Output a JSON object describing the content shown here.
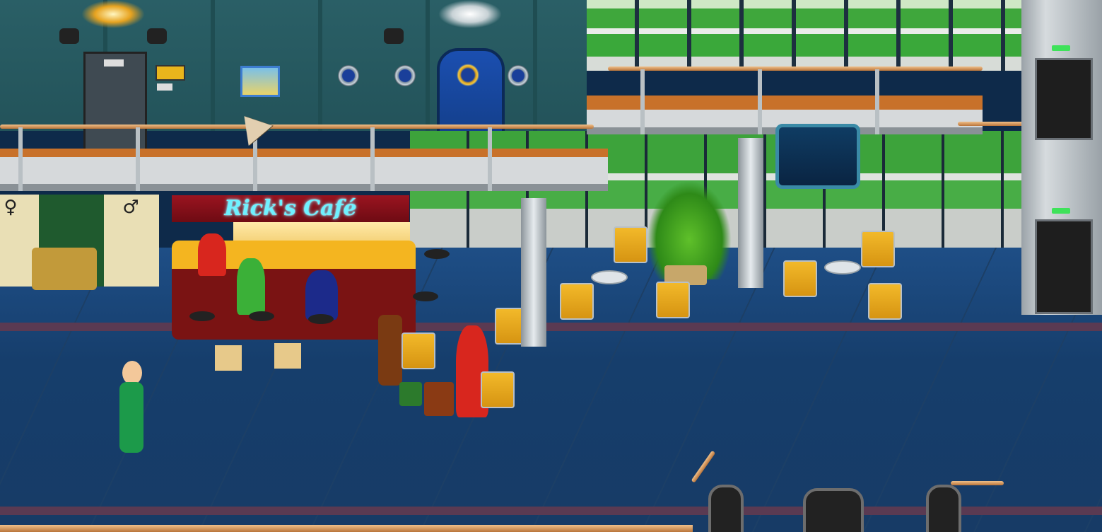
{
  "scene": {
    "cafe": {
      "sign_text": "Rick's Café"
    },
    "colors": {
      "wall": "#2a5f66",
      "floor": "#1e4e86",
      "railing": "#c8712a",
      "cafe_sign": "#6ff1ff",
      "cafe_sign_bg": "#8a111c",
      "elevator_light": "#3ee25a"
    },
    "icons": {
      "cursor": "arrow-cursor-icon",
      "restroom_women": "women-restroom-icon",
      "restroom_men": "men-restroom-icon",
      "monitor": "tv-monitor-icon",
      "elevator": "elevator-icon"
    }
  }
}
